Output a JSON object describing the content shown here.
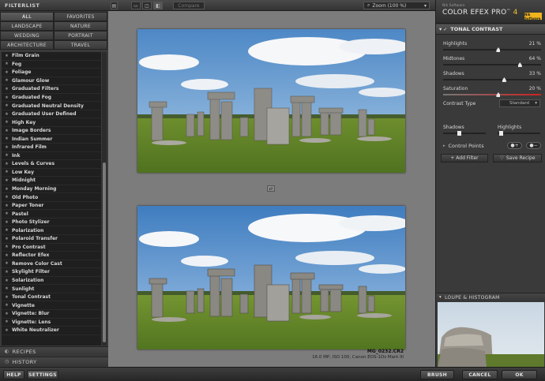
{
  "filterlist": {
    "title": "FILTERLIST",
    "categories": [
      "ALL",
      "FAVORITES",
      "LANDSCAPE",
      "NATURE",
      "WEDDING",
      "PORTRAIT",
      "ARCHITECTURE",
      "TRAVEL"
    ],
    "active_category": "ALL",
    "items": [
      "Film Grain",
      "Fog",
      "Foliage",
      "Glamour Glow",
      "Graduated Filters",
      "Graduated Fog",
      "Graduated Neutral Density",
      "Graduated User Defined",
      "High Key",
      "Image Borders",
      "Indian Summer",
      "Infrared Film",
      "Ink",
      "Levels & Curves",
      "Low Key",
      "Midnight",
      "Monday Morning",
      "Old Photo",
      "Paper Toner",
      "Pastel",
      "Photo Stylizer",
      "Polarization",
      "Polaroid Transfer",
      "Pro Contrast",
      "Reflector Efex",
      "Remove Color Cast",
      "Skylight Filter",
      "Solarization",
      "Sunlight",
      "Tonal Contrast",
      "Vignette",
      "Vignette: Blur",
      "Vignette: Lens",
      "White Neutralizer"
    ]
  },
  "sections": {
    "recipes": "RECIPES",
    "history": "HISTORY"
  },
  "toolbar": {
    "compare": "Compare",
    "zoom": "Zoom (100 %)"
  },
  "image_meta": {
    "filename": "MG_0232.CR2",
    "details": "16.0 MP, ISO 100, Canon EOS-1Ds Mark III"
  },
  "brand": {
    "company": "Nik Software",
    "product": "COLOR EFEX PRO",
    "tm": "™",
    "version": "4",
    "logo_text": "Nik Software"
  },
  "filter_panel": {
    "name": "TONAL CONTRAST",
    "sliders": [
      {
        "label": "Highlights",
        "value": "21",
        "unit": "%",
        "fraction": 0.56
      },
      {
        "label": "Midtones",
        "value": "64",
        "unit": "%",
        "fraction": 0.78
      },
      {
        "label": "Shadows",
        "value": "33",
        "unit": "%",
        "fraction": 0.62
      },
      {
        "label": "Saturation",
        "value": "20",
        "unit": "%",
        "fraction": 0.56
      }
    ],
    "contrast_type_label": "Contrast Type",
    "contrast_type_value": "Standard",
    "shadows_label": "Shadows",
    "highlights_label": "Highlights",
    "control_points_label": "Control Points",
    "add_filter": "+ Add Filter",
    "save_recipe": "Save Recipe"
  },
  "loupe": {
    "title": "LOUPE & HISTOGRAM"
  },
  "bottom": {
    "help": "HELP",
    "settings": "SETTINGS",
    "brush": "BRUSH",
    "cancel": "CANCEL",
    "ok": "OK"
  },
  "colors": {
    "accent_gold": "#f2c230",
    "panel": "#3a3a3a",
    "canvas": "#7c7c7c"
  }
}
